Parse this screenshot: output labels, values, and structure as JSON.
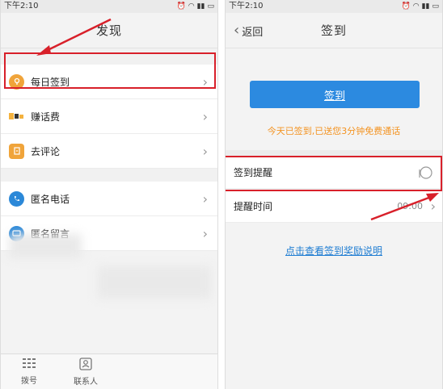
{
  "left": {
    "status": {
      "time": "下午2:10"
    },
    "header": {
      "title": "发现"
    },
    "items": [
      {
        "label": "每日签到",
        "icon": "location-icon",
        "color": "#f0a43a"
      },
      {
        "label": "赚话费",
        "icon": "coins-icon",
        "color": "#f4b23e"
      },
      {
        "label": "去评论",
        "icon": "comment-icon",
        "color": "#f0a43a"
      },
      {
        "label": "匿名电话",
        "icon": "phone-icon",
        "color": "#2b88d8"
      },
      {
        "label": "匿名留言",
        "icon": "message-icon",
        "color": "#2b88d8"
      }
    ],
    "tabs": [
      {
        "label": "拨号",
        "icon": "dialpad-icon"
      },
      {
        "label": "联系人",
        "icon": "contacts-icon"
      }
    ]
  },
  "right": {
    "status": {
      "time": "下午2:10"
    },
    "header": {
      "back_label": "返回",
      "title": "签到"
    },
    "signin_button": "签到",
    "signin_message": "今天已签到,已送您3分钟免费通话",
    "reminder_label": "签到提醒",
    "reminder_time_label": "提醒时间",
    "reminder_time_value": "09:00",
    "reward_link": "点击查看签到奖励说明"
  },
  "colors": {
    "highlight": "#d8202a",
    "accent": "#2c8ae0",
    "notice": "#f39321"
  }
}
